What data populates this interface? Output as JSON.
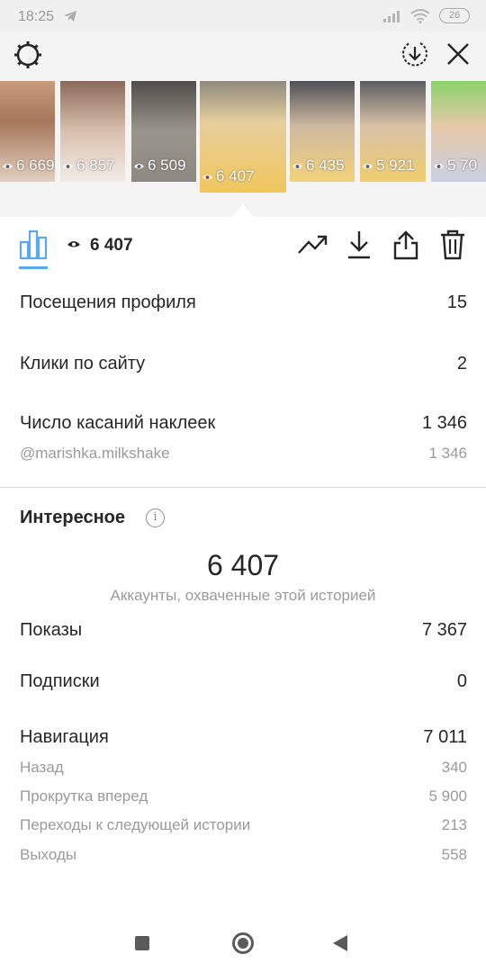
{
  "status_bar": {
    "time": "18:25",
    "battery": "26"
  },
  "thumbnails": [
    {
      "views": "6 669"
    },
    {
      "views": "6 857"
    },
    {
      "views": "6 509"
    },
    {
      "views": "6 407"
    },
    {
      "views": "6 435"
    },
    {
      "views": "5 921"
    },
    {
      "views": "5 70"
    }
  ],
  "toolbar": {
    "views_count": "6 407"
  },
  "actions": {
    "profile_visits": {
      "label": "Посещения профиля",
      "value": "15"
    },
    "website_clicks": {
      "label": "Клики по сайту",
      "value": "2"
    },
    "sticker_taps": {
      "label": "Число касаний наклеек",
      "value": "1 346"
    },
    "sticker_mention": {
      "label": "@marishka.milkshake",
      "value": "1 346"
    }
  },
  "discovery": {
    "title": "Интересное",
    "reach_value": "6 407",
    "reach_caption": "Аккаунты, охваченные этой историей",
    "impressions": {
      "label": "Показы",
      "value": "7 367"
    },
    "follows": {
      "label": "Подписки",
      "value": "0"
    },
    "navigation": {
      "label": "Навигация",
      "value": "7 011"
    },
    "back": {
      "label": "Назад",
      "value": "340"
    },
    "forward": {
      "label": "Прокрутка вперед",
      "value": "5 900"
    },
    "next_story": {
      "label": "Переходы к следующей истории",
      "value": "213"
    },
    "exits": {
      "label": "Выходы",
      "value": "558"
    }
  },
  "colors": {
    "accent": "#5aa8f0",
    "text": "#262626",
    "muted": "#9a9a9a"
  }
}
